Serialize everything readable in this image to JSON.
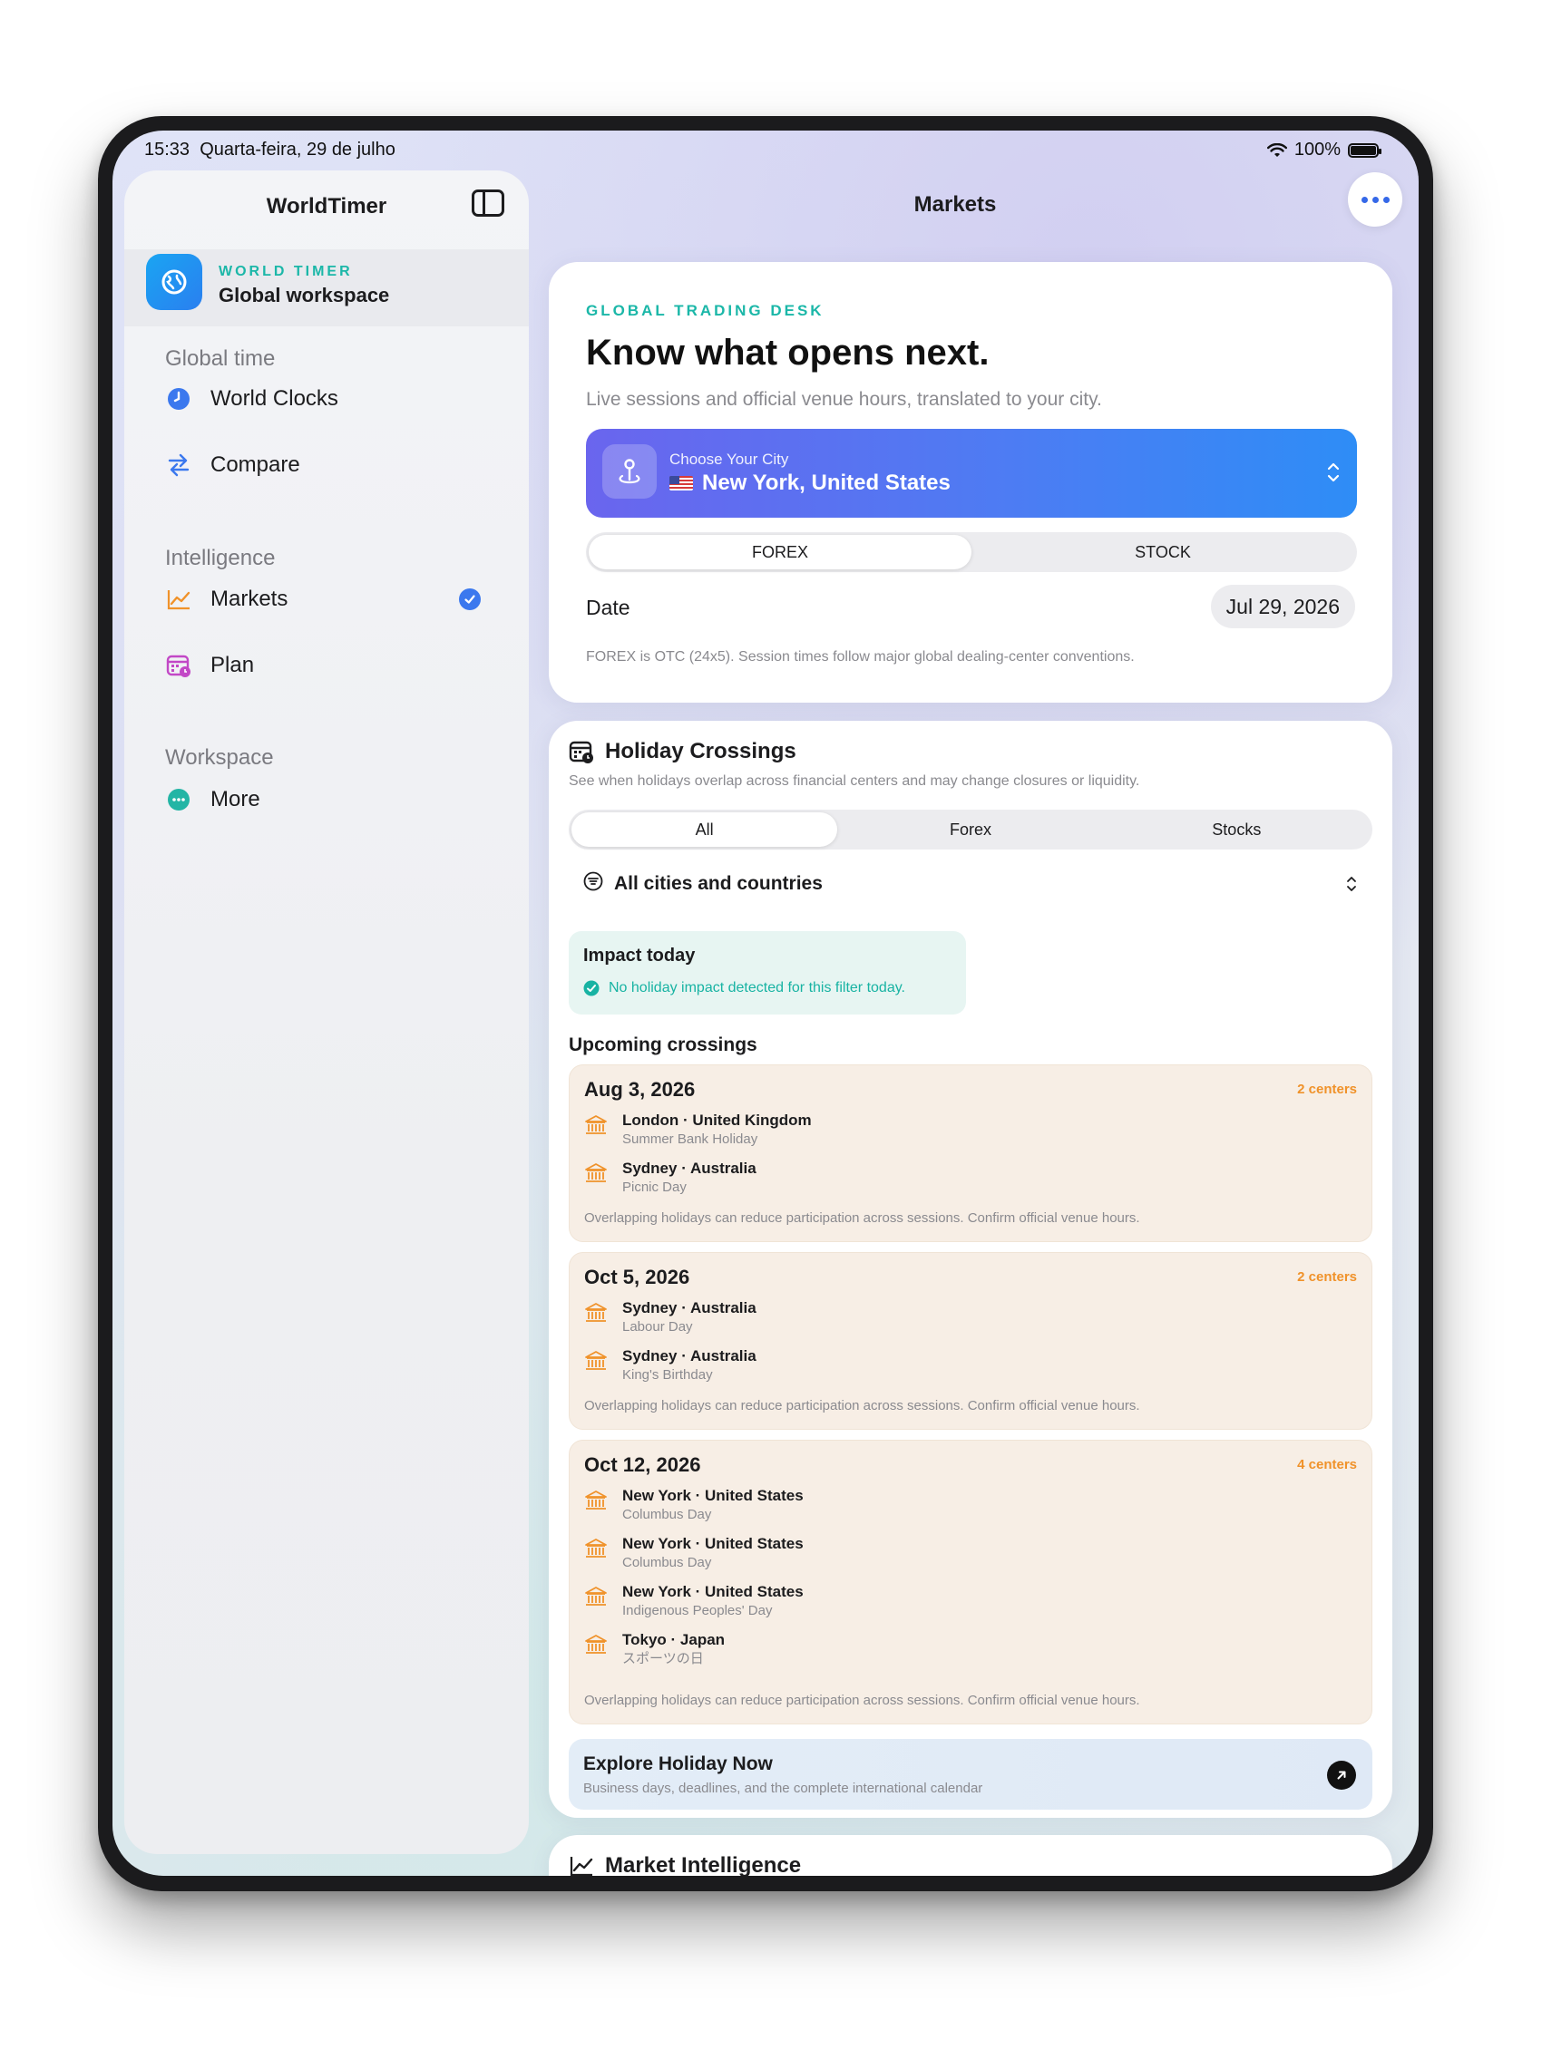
{
  "status_bar": {
    "time": "15:33",
    "date": "Quarta-feira, 29 de julho",
    "battery": "100%",
    "battery_level": 1.0
  },
  "sidebar": {
    "title": "WorldTimer",
    "workspace": {
      "tag": "WORLD TIMER",
      "name": "Global workspace"
    },
    "sections": [
      {
        "label": "Global time"
      },
      {
        "label": "Intelligence"
      },
      {
        "label": "Workspace"
      }
    ],
    "items": [
      {
        "label": "World Clocks",
        "icon": "clock-icon"
      },
      {
        "label": "Compare",
        "icon": "arrows-swap-icon"
      },
      {
        "label": "Markets",
        "icon": "chart-line-icon",
        "selected": true
      },
      {
        "label": "Plan",
        "icon": "calendar-icon"
      },
      {
        "label": "More",
        "icon": "ellipsis-circle-icon"
      }
    ]
  },
  "header": {
    "title": "Markets"
  },
  "trading_desk": {
    "eyebrow": "GLOBAL TRADING DESK",
    "headline": "Know what opens next.",
    "subtitle": "Live sessions and official venue hours, translated to your city.",
    "city_label": "Choose Your City",
    "city_value": "New York, United States",
    "tabs": [
      "FOREX",
      "STOCK"
    ],
    "selected_tab": "FOREX",
    "date_label": "Date",
    "date_value": "Jul 29, 2026",
    "note": "FOREX is OTC (24x5). Session times follow major global dealing-center conventions."
  },
  "holiday_crossings": {
    "title": "Holiday Crossings",
    "subtitle": "See when holidays overlap across financial centers and may change closures or liquidity.",
    "filters": [
      "All",
      "Forex",
      "Stocks"
    ],
    "selected_filter": "All",
    "location_filter": "All cities and countries",
    "impact_title": "Impact today",
    "impact_message": "No holiday impact detected for this filter today.",
    "upcoming_label": "Upcoming crossings",
    "crossings": [
      {
        "date": "Aug 3, 2026",
        "count": "2 centers",
        "entries": [
          {
            "place": "London · United Kingdom",
            "holiday": "Summer Bank Holiday"
          },
          {
            "place": "Sydney · Australia",
            "holiday": "Picnic Day"
          }
        ],
        "footer": "Overlapping holidays can reduce participation across sessions. Confirm official venue hours."
      },
      {
        "date": "Oct 5, 2026",
        "count": "2 centers",
        "entries": [
          {
            "place": "Sydney · Australia",
            "holiday": "Labour Day"
          },
          {
            "place": "Sydney · Australia",
            "holiday": "King's Birthday"
          }
        ],
        "footer": "Overlapping holidays can reduce participation across sessions. Confirm official venue hours."
      },
      {
        "date": "Oct 12, 2026",
        "count": "4 centers",
        "entries": [
          {
            "place": "New York · United States",
            "holiday": "Columbus Day"
          },
          {
            "place": "New York · United States",
            "holiday": "Columbus Day"
          },
          {
            "place": "New York · United States",
            "holiday": "Indigenous Peoples' Day"
          },
          {
            "place": "Tokyo · Japan",
            "holiday": "スポーツの日"
          }
        ],
        "footer": "Overlapping holidays can reduce participation across sessions. Confirm official venue hours."
      }
    ],
    "explore_title": "Explore Holiday Now",
    "explore_subtitle": "Business days, deadlines, and the complete international calendar"
  },
  "market_intelligence": {
    "title": "Market Intelligence"
  },
  "colors": {
    "accent_teal": "#1bb7a8",
    "accent_blue": "#3b78ee",
    "accent_orange": "#f0922a"
  }
}
